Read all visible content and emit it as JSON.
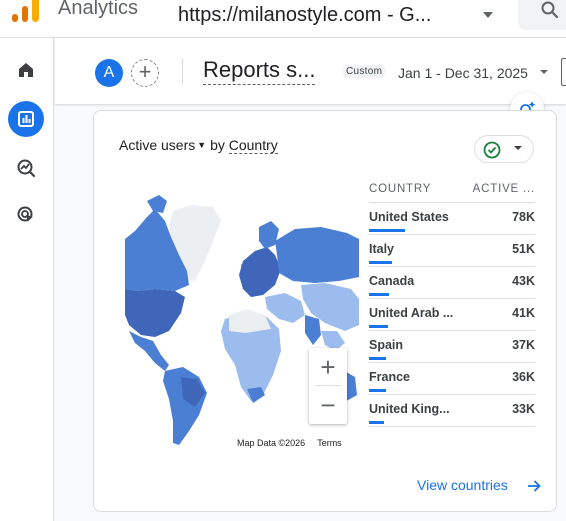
{
  "app": {
    "name": "Analytics",
    "property": "https://milanostyle.com - G..."
  },
  "header": {
    "avatar_letter": "A",
    "add_label": "+",
    "report_title": "Reports s...",
    "date_chip": "Custom",
    "date_range": "Jan 1 - Dec 31, 2025"
  },
  "nav": {
    "items": [
      "home-icon",
      "reports-icon",
      "explore-icon",
      "advertising-icon"
    ],
    "active": "reports-icon"
  },
  "card": {
    "metric": "Active users",
    "by_label": "by",
    "dimension": "Country",
    "zoom_in": "+",
    "zoom_out": "−",
    "map_attribution": "Map Data ©2026",
    "map_terms": "Terms",
    "table": {
      "headers": [
        "COUNTRY",
        "ACTIVE ..."
      ],
      "rows": [
        {
          "country": "United States",
          "value": "78K",
          "share": 1.0
        },
        {
          "country": "Italy",
          "value": "51K",
          "share": 0.65
        },
        {
          "country": "Canada",
          "value": "43K",
          "share": 0.55
        },
        {
          "country": "United Arab ...",
          "value": "41K",
          "share": 0.53
        },
        {
          "country": "Spain",
          "value": "37K",
          "share": 0.47
        },
        {
          "country": "France",
          "value": "36K",
          "share": 0.46
        },
        {
          "country": "United King...",
          "value": "33K",
          "share": 0.42
        }
      ]
    },
    "view_link": "View countries"
  },
  "colors": {
    "accent": "#1a73e8",
    "ok_green": "#188038",
    "map_dark": "#3f66b8",
    "map_mid": "#4a7fd4",
    "map_light": "#9cbcee",
    "map_none": "#eceff1"
  }
}
